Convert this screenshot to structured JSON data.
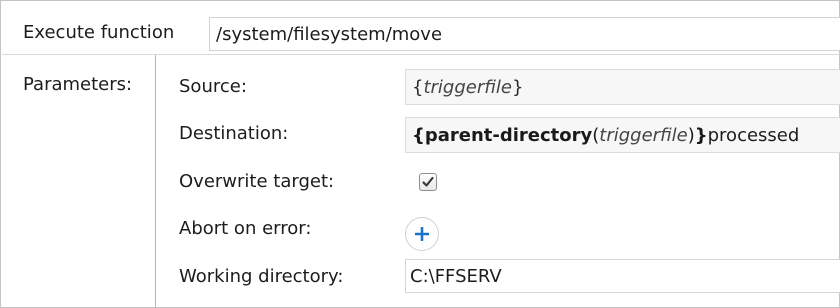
{
  "execute": {
    "label": "Execute function",
    "value": "/system/filesystem/move"
  },
  "parameters": {
    "label": "Parameters:",
    "rows": [
      {
        "label": "Source:",
        "value_parts": {
          "open": "{",
          "arg": "triggerfile",
          "close": "}"
        }
      },
      {
        "label": "Destination:",
        "value_parts": {
          "open": "{",
          "function": "parent-directory",
          "paren_open": "(",
          "arg": "triggerfile",
          "paren_close": ")",
          "close": "}",
          "suffix": "processed"
        }
      },
      {
        "label": "Overwrite target:",
        "checked": true
      },
      {
        "label": "Abort on error:",
        "icon": "plus-icon"
      },
      {
        "label": "Working directory:",
        "value": "C:\\FFSERV"
      }
    ]
  },
  "colors": {
    "plus_icon": "#1a73c8",
    "checkmark": "#3a3a3a"
  }
}
